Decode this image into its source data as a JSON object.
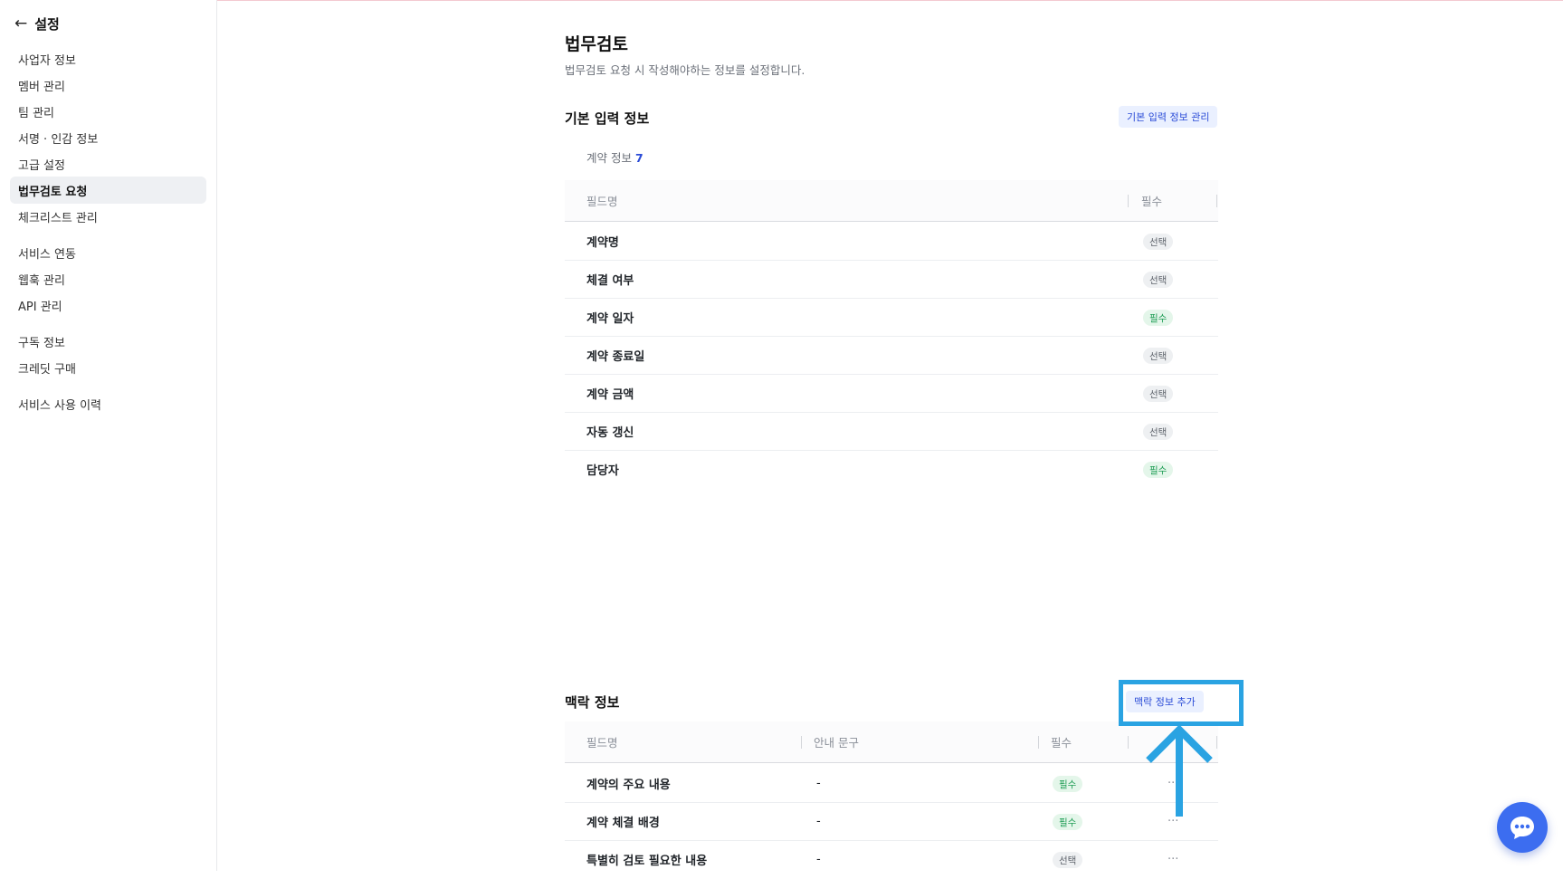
{
  "sidebar": {
    "back_title": "설정",
    "items": [
      {
        "label": "사업자 정보"
      },
      {
        "label": "멤버 관리"
      },
      {
        "label": "팀 관리"
      },
      {
        "label": "서명 · 인감 정보"
      },
      {
        "label": "고급 설정"
      },
      {
        "label": "법무검토 요청",
        "active": true
      },
      {
        "label": "체크리스트 관리"
      },
      {
        "label": "서비스 연동"
      },
      {
        "label": "웹훅 관리"
      },
      {
        "label": "API 관리"
      },
      {
        "label": "구독 정보"
      },
      {
        "label": "크레딧 구매"
      },
      {
        "label": "서비스 사용 이력"
      }
    ]
  },
  "page": {
    "title": "법무검토",
    "description": "법무검토 요청 시 작성해야하는 정보를 설정합니다."
  },
  "basic": {
    "title": "기본 입력 정보",
    "manage_button": "기본 입력 정보 관리",
    "tab_label": "계약 정보",
    "tab_count": "7",
    "headers": {
      "field": "필드명",
      "required": "필수"
    },
    "rows": [
      {
        "name": "계약명",
        "badge": "선택",
        "type": "opt"
      },
      {
        "name": "체결 여부",
        "badge": "선택",
        "type": "opt"
      },
      {
        "name": "계약 일자",
        "badge": "필수",
        "type": "req"
      },
      {
        "name": "계약 종료일",
        "badge": "선택",
        "type": "opt"
      },
      {
        "name": "계약 금액",
        "badge": "선택",
        "type": "opt"
      },
      {
        "name": "자동 갱신",
        "badge": "선택",
        "type": "opt"
      },
      {
        "name": "담당자",
        "badge": "필수",
        "type": "req"
      }
    ]
  },
  "context": {
    "title": "맥락 정보",
    "add_button": "맥락 정보 추가",
    "headers": {
      "field": "필드명",
      "guide": "안내 문구",
      "required": "필수"
    },
    "rows": [
      {
        "name": "계약의 주요 내용",
        "guide": "-",
        "badge": "필수",
        "type": "req",
        "more": "···"
      },
      {
        "name": "계약 체결 배경",
        "guide": "-",
        "badge": "필수",
        "type": "req",
        "more": "···"
      },
      {
        "name": "특별히 검토 필요한 내용",
        "guide": "-",
        "badge": "선택",
        "type": "opt",
        "more": "···"
      }
    ]
  },
  "colors": {
    "accent": "#2a4bd7",
    "required_badge": "#1f9d55",
    "annotation": "#2aa3e2",
    "chat_button": "#3c6df0"
  },
  "icons": {
    "back": "arrow-left-icon",
    "chat": "chat-bubble-icon",
    "more": "more-horizontal-icon"
  }
}
